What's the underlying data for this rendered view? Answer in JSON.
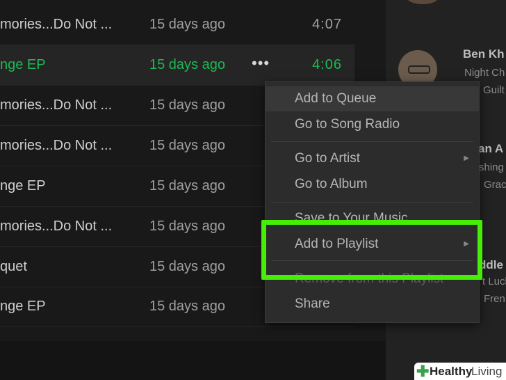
{
  "tracks": [
    {
      "title": "mories...Do Not ...",
      "added": "15 days ago",
      "duration": "4:07"
    },
    {
      "title": "nge EP",
      "added": "15 days ago",
      "duration": "4:06",
      "active": true,
      "more": "•••"
    },
    {
      "title": "mories...Do Not ...",
      "added": "15 days ago",
      "duration": ""
    },
    {
      "title": "mories...Do Not ...",
      "added": "15 days ago",
      "duration": ""
    },
    {
      "title": "nge EP",
      "added": "15 days ago",
      "duration": ""
    },
    {
      "title": "mories...Do Not ...",
      "added": "15 days ago",
      "duration": ""
    },
    {
      "title": "quet",
      "added": "15 days ago",
      "duration": ""
    },
    {
      "title": "nge EP",
      "added": "15 days ago",
      "duration": ""
    }
  ],
  "context_menu": {
    "items": [
      {
        "label": "Add to Queue"
      },
      {
        "label": "Go to Song Radio"
      },
      {
        "label": "Go to Artist"
      },
      {
        "label": "Go to Album"
      },
      {
        "label": "Save to Your Music"
      },
      {
        "label": "Add to Playlist"
      },
      {
        "label": "Remove from this Playlist"
      },
      {
        "label": "Share"
      }
    ]
  },
  "friend_activity": [
    {
      "name": "Ben Kh",
      "line1": "Night Ch",
      "line2": "Guilt"
    },
    {
      "name": "an A",
      "line1": "shing",
      "line2": "Grac"
    },
    {
      "name": "ddle",
      "line1": "t Luck",
      "line2": "Fren"
    }
  ],
  "watermark": {
    "brand": "Healthy",
    "suffix": "Living"
  },
  "colors": {
    "accent_green": "#1db954",
    "highlight_green": "#46ee07"
  }
}
